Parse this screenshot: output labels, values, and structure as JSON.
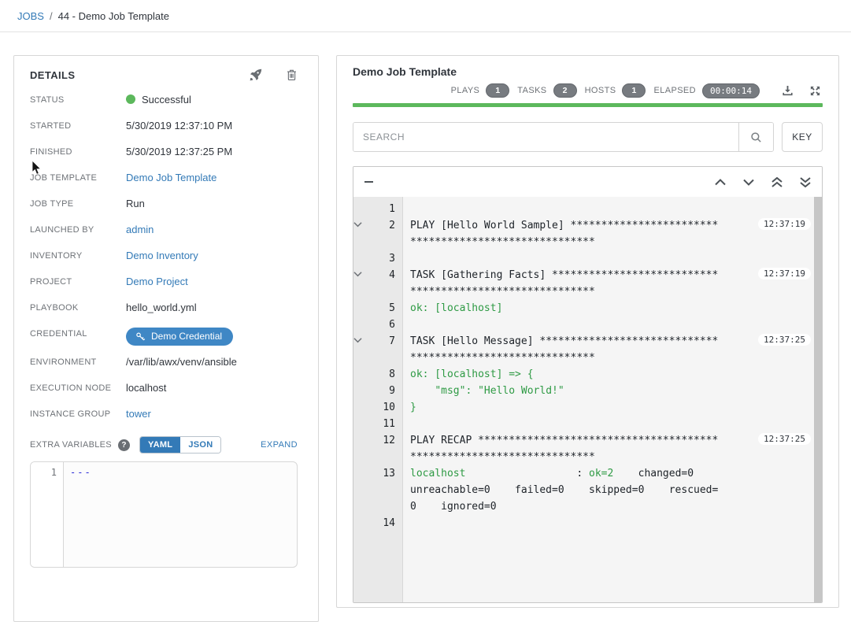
{
  "breadcrumb": {
    "jobs_label": "JOBS",
    "separator": "/",
    "current": "44 - Demo Job Template"
  },
  "details": {
    "title": "DETAILS",
    "rows": [
      {
        "label": "STATUS",
        "type": "status",
        "value": "Successful"
      },
      {
        "label": "STARTED",
        "type": "text",
        "value": "5/30/2019 12:37:10 PM"
      },
      {
        "label": "FINISHED",
        "type": "text",
        "value": "5/30/2019 12:37:25 PM"
      },
      {
        "label": "JOB TEMPLATE",
        "type": "link",
        "value": "Demo Job Template"
      },
      {
        "label": "JOB TYPE",
        "type": "text",
        "value": "Run"
      },
      {
        "label": "LAUNCHED BY",
        "type": "link",
        "value": "admin"
      },
      {
        "label": "INVENTORY",
        "type": "link",
        "value": "Demo Inventory"
      },
      {
        "label": "PROJECT",
        "type": "link",
        "value": "Demo Project"
      },
      {
        "label": "PLAYBOOK",
        "type": "text",
        "value": "hello_world.yml"
      },
      {
        "label": "CREDENTIAL",
        "type": "credential",
        "value": "Demo Credential"
      },
      {
        "label": "ENVIRONMENT",
        "type": "text",
        "value": "/var/lib/awx/venv/ansible"
      },
      {
        "label": "EXECUTION NODE",
        "type": "text",
        "value": "localhost"
      },
      {
        "label": "INSTANCE GROUP",
        "type": "link",
        "value": "tower"
      }
    ],
    "extra_variables": {
      "label": "EXTRA VARIABLES",
      "help": "?",
      "toggle": {
        "yaml": "YAML",
        "json": "JSON",
        "selected": "YAML"
      },
      "expand_label": "EXPAND",
      "editor_line_number": "1",
      "editor_content": "---"
    }
  },
  "job_output": {
    "title": "Demo Job Template",
    "stats": [
      {
        "label": "PLAYS",
        "value": "1"
      },
      {
        "label": "TASKS",
        "value": "2"
      },
      {
        "label": "HOSTS",
        "value": "1"
      },
      {
        "label": "ELAPSED",
        "value": "00:00:14",
        "mono": true
      }
    ],
    "search_placeholder": "SEARCH",
    "key_button_label": "KEY",
    "lines": [
      {
        "num": "1",
        "expandable": false,
        "time": "",
        "segments": []
      },
      {
        "num": "2",
        "expandable": true,
        "time": "12:37:19",
        "segments": [
          {
            "text": "PLAY [Hello World Sample] "
          },
          {
            "stars": 54
          }
        ]
      },
      {
        "num": "3",
        "expandable": false,
        "time": "",
        "segments": []
      },
      {
        "num": "4",
        "expandable": true,
        "time": "12:37:19",
        "segments": [
          {
            "text": "TASK [Gathering Facts] "
          },
          {
            "stars": 57
          }
        ]
      },
      {
        "num": "5",
        "expandable": false,
        "time": "",
        "segments": [
          {
            "text": "ok: [localhost]",
            "color": "green"
          }
        ]
      },
      {
        "num": "6",
        "expandable": false,
        "time": "",
        "segments": []
      },
      {
        "num": "7",
        "expandable": true,
        "time": "12:37:25",
        "segments": [
          {
            "text": "TASK [Hello Message] "
          },
          {
            "stars": 59
          }
        ]
      },
      {
        "num": "8",
        "expandable": false,
        "time": "",
        "segments": [
          {
            "text": "ok: [localhost] => {",
            "color": "green"
          }
        ]
      },
      {
        "num": "9",
        "expandable": false,
        "time": "",
        "segments": [
          {
            "text": "    \"msg\": \"Hello World!\"",
            "color": "green"
          }
        ]
      },
      {
        "num": "10",
        "expandable": false,
        "time": "",
        "segments": [
          {
            "text": "}",
            "color": "green"
          }
        ]
      },
      {
        "num": "11",
        "expandable": false,
        "time": "",
        "segments": []
      },
      {
        "num": "12",
        "expandable": false,
        "time": "12:37:25",
        "segments": [
          {
            "text": "PLAY RECAP "
          },
          {
            "stars": 69
          }
        ]
      },
      {
        "num": "13",
        "expandable": false,
        "time": "",
        "segments": [
          {
            "text": "localhost",
            "color": "green"
          },
          {
            "spaces": 18
          },
          {
            "text": ": "
          },
          {
            "text": "ok=2",
            "color": "green"
          },
          {
            "text": "    changed=0    unreachable=0    failed=0    skipped=0    rescued=0    ignored=0"
          }
        ]
      },
      {
        "num": "14",
        "expandable": false,
        "time": "",
        "segments": []
      }
    ]
  },
  "colors": {
    "link": "#337ab7",
    "success_green": "#5cb85c",
    "terminal_green": "#2e9a44",
    "badge_bg": "#777b80",
    "credential_chip_bg": "#3f87c5"
  }
}
